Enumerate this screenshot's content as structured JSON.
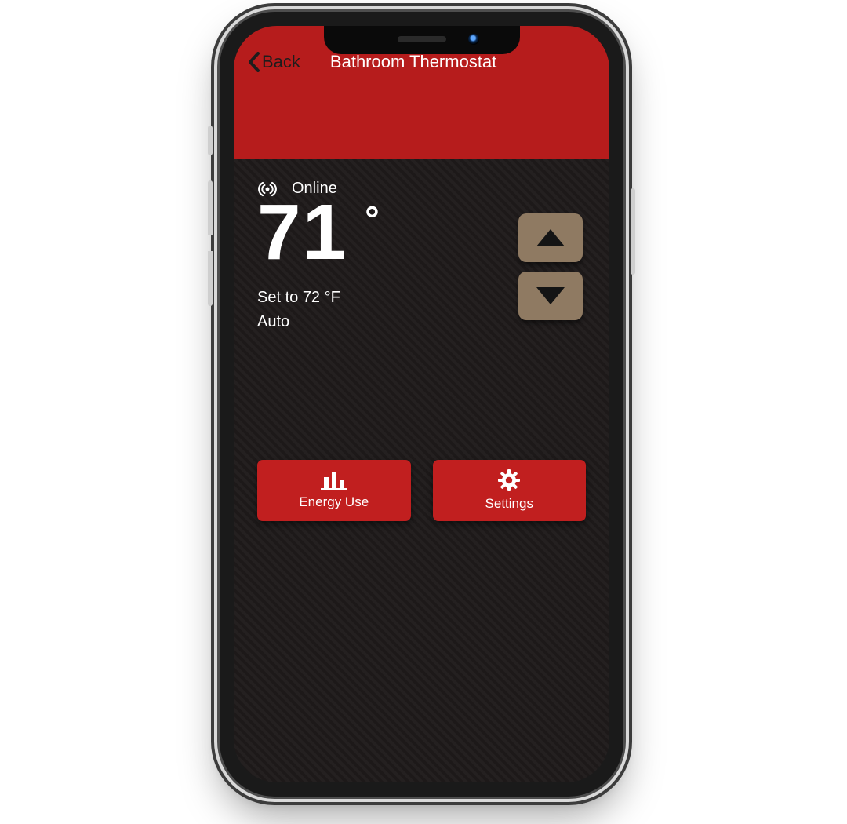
{
  "header": {
    "back_label": "Back",
    "title": "Bathroom Thermostat"
  },
  "status": {
    "icon": "signal-icon",
    "text": "Online"
  },
  "temperature": {
    "current": "71",
    "degree_symbol": "°",
    "set_line": "Set to 72  °F",
    "mode_line": "Auto"
  },
  "controls": {
    "up_icon": "triangle-up-icon",
    "down_icon": "triangle-down-icon"
  },
  "actions": {
    "energy": {
      "icon": "bar-chart-icon",
      "label": "Energy Use"
    },
    "settings": {
      "icon": "gear-icon",
      "label": "Settings"
    }
  },
  "colors": {
    "brand_red": "#b61c1c",
    "button_red": "#c11f1f",
    "arrow_btn": "#8f7a62",
    "body_bg": "#1f1b1b"
  }
}
